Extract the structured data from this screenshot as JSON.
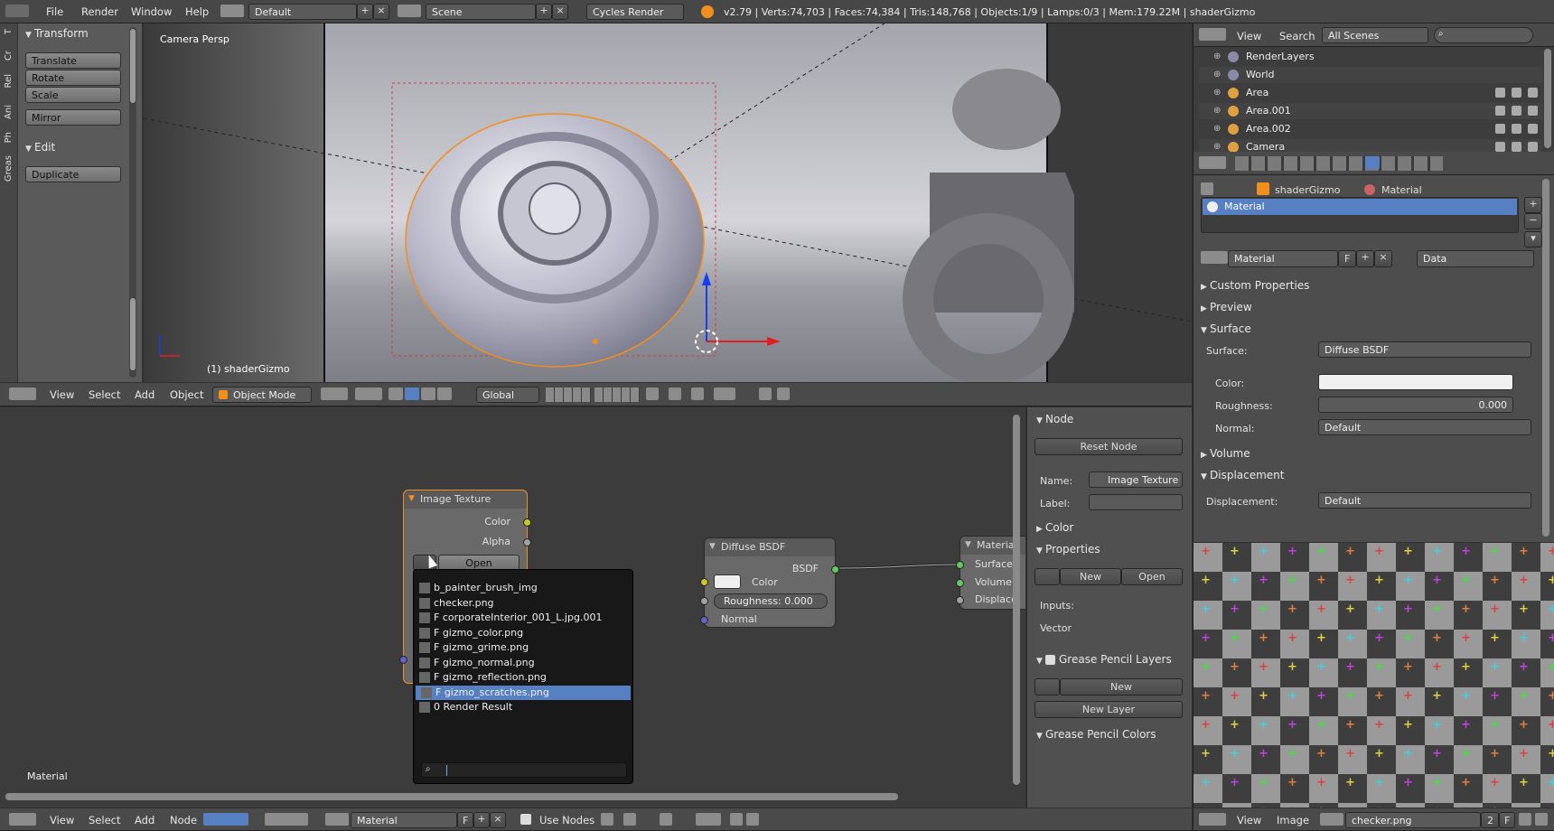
{
  "topbar": {
    "menus": [
      "File",
      "Render",
      "Window",
      "Help"
    ],
    "layout": "Default",
    "scene": "Scene",
    "engine": "Cycles Render",
    "stats": "v2.79 | Verts:74,703 | Faces:74,384 | Tris:148,768 | Objects:1/9 | Lamps:0/3 | Mem:179.22M | shaderGizmo"
  },
  "toolshelf": {
    "tabs": [
      "T",
      "Cr",
      "Rel",
      "Ani",
      "Ph",
      "Greas"
    ],
    "transform_title": "Transform",
    "transform_buttons": [
      "Translate",
      "Rotate",
      "Scale",
      "Mirror"
    ],
    "edit_title": "Edit",
    "edit_buttons": [
      "Duplicate"
    ]
  },
  "viewport": {
    "label": "Camera Persp",
    "object_label": "(1) shaderGizmo"
  },
  "view_header": {
    "menus": [
      "View",
      "Select",
      "Add",
      "Object"
    ],
    "mode": "Object Mode",
    "orientation": "Global"
  },
  "node_editor": {
    "label": "Material",
    "image_node": {
      "title": "Image Texture",
      "out_color": "Color",
      "out_alpha": "Alpha",
      "open": "Open"
    },
    "diffuse_node": {
      "title": "Diffuse BSDF",
      "out": "BSDF",
      "color": "Color",
      "roughness": "Roughness:",
      "roughness_val": "0.000",
      "normal": "Normal"
    },
    "output_node": {
      "title": "Materia",
      "in_surface": "Surface",
      "in_volume": "Volume",
      "in_displace": "Displace"
    }
  },
  "image_popup": {
    "items": [
      "b_painter_brush_img",
      "checker.png",
      "F corporateInterior_001_L.jpg.001",
      "F gizmo_color.png",
      "F gizmo_grime.png",
      "F gizmo_normal.png",
      "F gizmo_reflection.png",
      "F gizmo_scratches.png",
      "0 Render Result"
    ],
    "selected_index": 7
  },
  "node_panel": {
    "node_title": "Node",
    "reset": "Reset Node",
    "name_label": "Name:",
    "name_value": "Image Texture",
    "label_label": "Label:",
    "color": "Color",
    "properties": "Properties",
    "new": "New",
    "open": "Open",
    "inputs": "Inputs:",
    "vector": "Vector",
    "gp_layers": "Grease Pencil Layers",
    "gp_new": "New",
    "gp_new_layer": "New Layer",
    "gp_colors": "Grease Pencil Colors"
  },
  "node_footer": {
    "menus": [
      "View",
      "Select",
      "Add",
      "Node"
    ],
    "material": "Material",
    "use_nodes": "Use Nodes",
    "fake_user": "F"
  },
  "outliner": {
    "menus": [
      "View",
      "Search"
    ],
    "filter": "All Scenes",
    "rows": [
      "RenderLayers",
      "World",
      "Area",
      "Area.001",
      "Area.002",
      "Camera"
    ]
  },
  "properties": {
    "breadcrumb_obj": "shaderGizmo",
    "breadcrumb_mat": "Material",
    "slot": "Material",
    "material_name": "Material",
    "fake_user": "F",
    "link": "Data",
    "sections": {
      "custom": "Custom Properties",
      "preview": "Preview",
      "surface": "Surface",
      "volume": "Volume",
      "displacement": "Displacement"
    },
    "surface_label": "Surface:",
    "surface_value": "Diffuse BSDF",
    "color_label": "Color:",
    "roughness_label": "Roughness:",
    "roughness_value": "0.000",
    "normal_label": "Normal:",
    "normal_value": "Default",
    "displacement_label": "Displacement:",
    "displacement_value": "Default"
  },
  "image_editor": {
    "menus": [
      "View",
      "Image"
    ],
    "image": "checker.png",
    "users": "2",
    "fake_user": "F"
  },
  "colors": {
    "accent": "#5680c2",
    "orange": "#f28e1c"
  }
}
